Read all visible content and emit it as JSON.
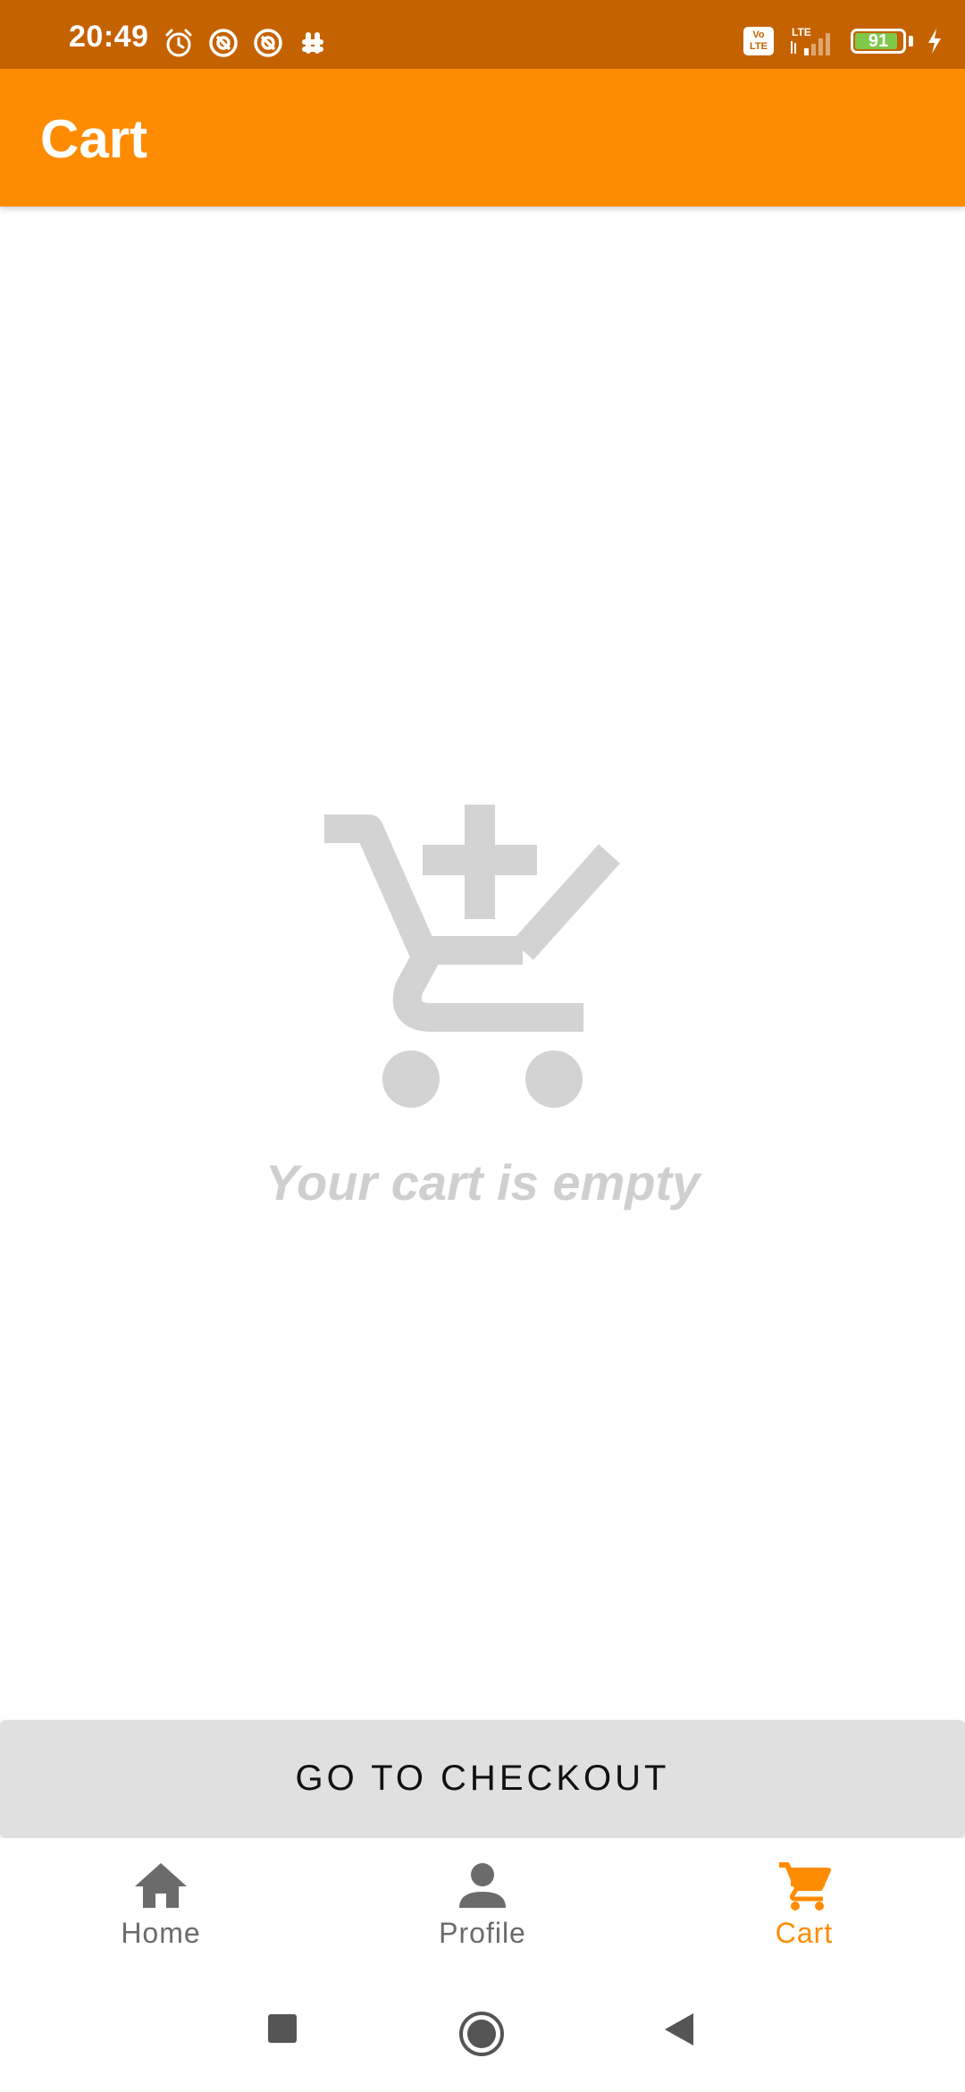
{
  "status_bar": {
    "time": "20:49",
    "left_icons": [
      "alarm-icon",
      "notification-app-icon",
      "notification-app-icon",
      "slack-icon"
    ],
    "volte_label": "Vo LTE",
    "network_label": "LTE",
    "battery_level": "91",
    "battery_fraction": 0.91,
    "charging": true
  },
  "app_bar": {
    "title": "Cart"
  },
  "empty_state": {
    "icon": "add-to-cart-icon",
    "message": "Your cart is empty"
  },
  "checkout": {
    "label": "GO TO CHECKOUT"
  },
  "bottom_nav": {
    "items": [
      {
        "label": "Home",
        "icon": "home-icon",
        "active": false
      },
      {
        "label": "Profile",
        "icon": "person-icon",
        "active": false
      },
      {
        "label": "Cart",
        "icon": "cart-icon",
        "active": true
      }
    ]
  },
  "system_nav": {
    "buttons": [
      "recents",
      "home",
      "back"
    ]
  },
  "colors": {
    "status_bar": "#c56200",
    "app_bar": "#ff8c00",
    "accent": "#ff8c00",
    "empty_state": "#cfcfcf",
    "inactive_nav": "#6b6b6b",
    "button_bg": "#e0e0e0"
  }
}
